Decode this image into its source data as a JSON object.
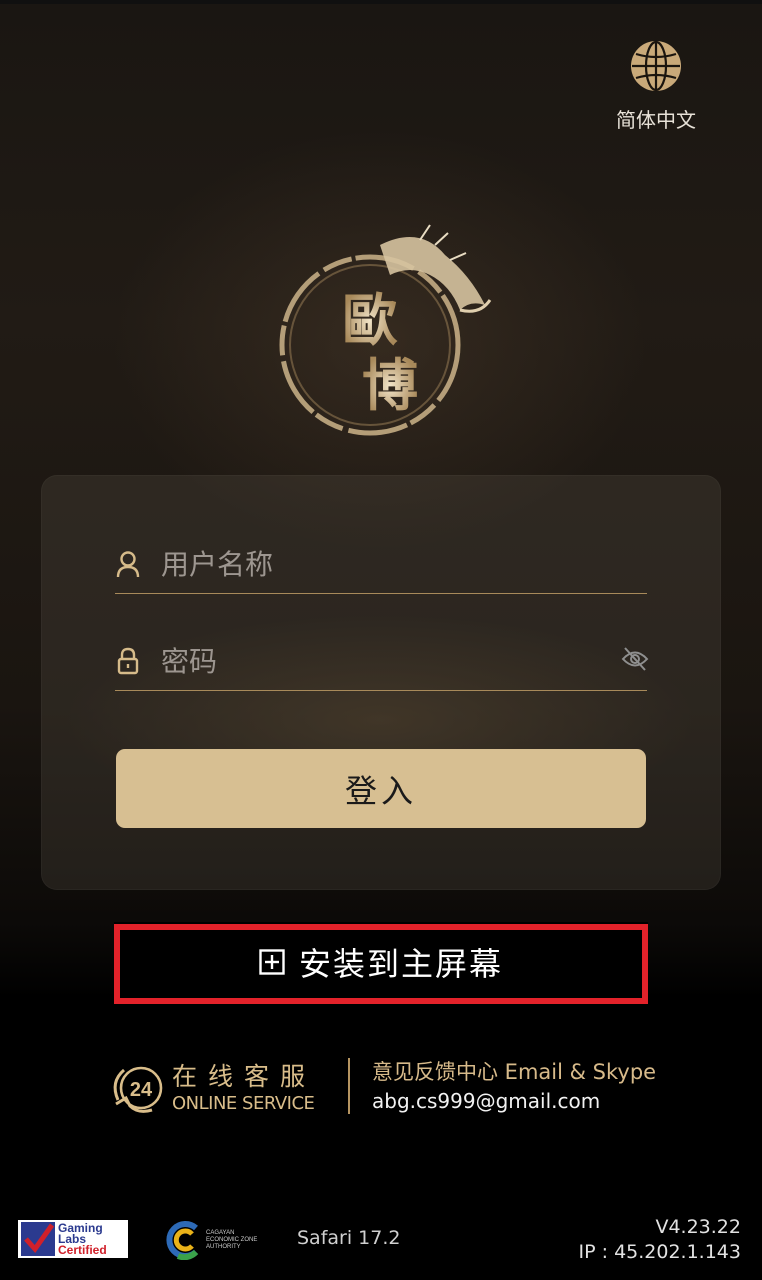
{
  "language": {
    "label": "简体中文",
    "icon": "globe-icon"
  },
  "logo": {
    "text": "歐博",
    "icon": "dragon-logo"
  },
  "login": {
    "username_placeholder": "用户名称",
    "password_placeholder": "密码",
    "submit_label": "登入"
  },
  "install": {
    "label": "安装到主屏幕",
    "icon": "plus-square-icon",
    "highlight_color": "#e3222a"
  },
  "service": {
    "badge": "24",
    "title_cn": "在线客服",
    "title_en": "ONLINE SERVICE",
    "feedback": "意见反馈中心 Email & Skype",
    "email": "abg.cs999@gmail.com"
  },
  "footer": {
    "gaming_labs": [
      "Gaming",
      "Labs",
      "Certified"
    ],
    "ceza": [
      "CAGAYAN",
      "ECONOMIC ZONE",
      "AUTHORITY"
    ],
    "browser": "Safari 17.2",
    "version": "V4.23.22",
    "ip": "IP : 45.202.1.143"
  },
  "colors": {
    "accent": "#d7bf92",
    "gold_text": "#d9bd8a",
    "background": "#000000"
  }
}
